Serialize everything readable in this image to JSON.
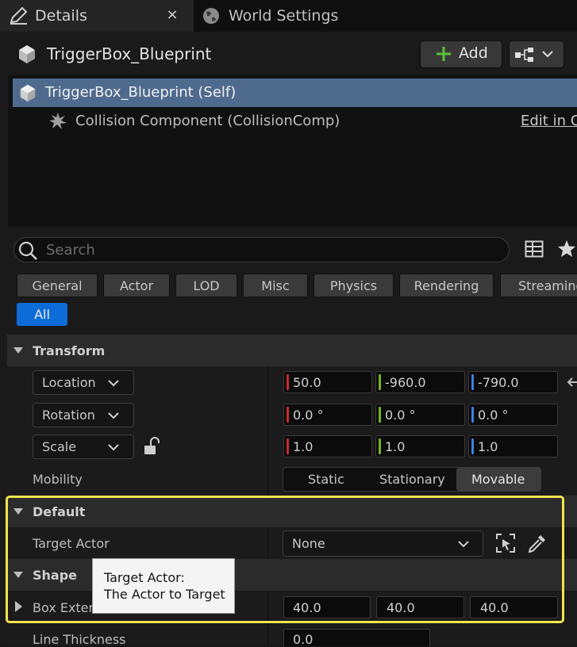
{
  "tabs": [
    {
      "label": "Details",
      "close": "×"
    },
    {
      "label": "World Settings"
    }
  ],
  "header": {
    "actor_name": "TriggerBox_Blueprint",
    "add_label": "Add"
  },
  "tree": {
    "self_label": "TriggerBox_Blueprint (Self)",
    "component_label": "Collision Component (CollisionComp)",
    "edit_link": "Edit in C"
  },
  "search": {
    "placeholder": "Search"
  },
  "filters": [
    "General",
    "Actor",
    "LOD",
    "Misc",
    "Physics",
    "Rendering",
    "Streaming"
  ],
  "filter_all": "All",
  "transform": {
    "title": "Transform",
    "location": {
      "label": "Location",
      "x": "50.0",
      "y": "-960.0",
      "z": "-790.0"
    },
    "rotation": {
      "label": "Rotation",
      "x": "0.0 °",
      "y": "0.0 °",
      "z": "0.0 °"
    },
    "scale": {
      "label": "Scale",
      "x": "1.0",
      "y": "1.0",
      "z": "1.0"
    },
    "mobility": {
      "label": "Mobility",
      "options": [
        "Static",
        "Stationary",
        "Movable"
      ],
      "selected": "Movable"
    }
  },
  "default_cat": {
    "title": "Default",
    "target_actor_label": "Target Actor",
    "target_actor_value": "None"
  },
  "shape": {
    "title": "Shape",
    "box_extent_label": "Box Extent",
    "box_extent": {
      "x": "40.0",
      "y": "40.0",
      "z": "40.0"
    },
    "line_thickness_label": "Line Thickness",
    "line_thickness": "0.0"
  },
  "tooltip": {
    "line1": "Target Actor:",
    "line2": "The Actor to Target"
  },
  "colors": {
    "x_axis": "#c92b2b",
    "y_axis": "#74b520",
    "z_axis": "#3f7fe0",
    "highlight": "#f2e34c",
    "selection": "#4e6b8e",
    "accent": "#0e6cd8"
  }
}
